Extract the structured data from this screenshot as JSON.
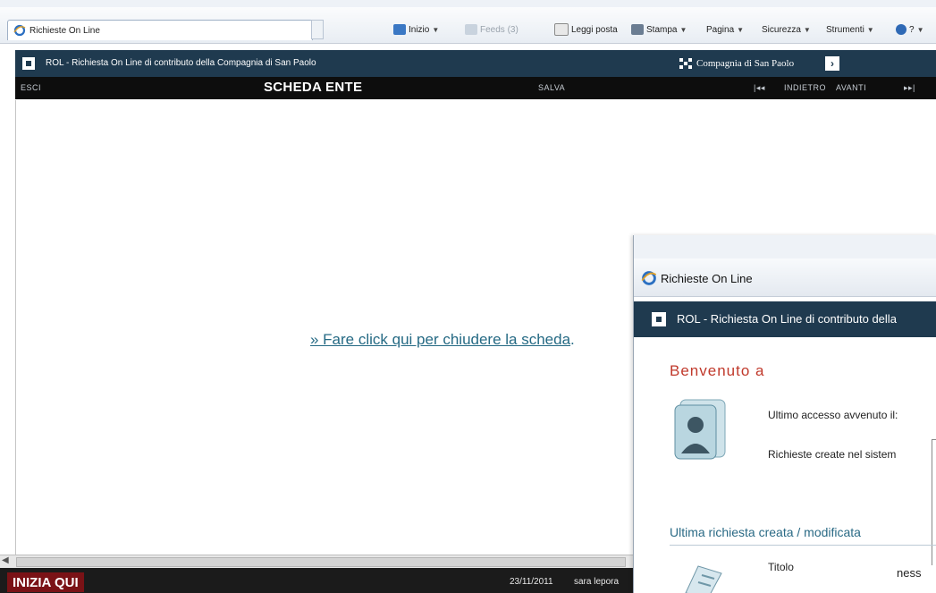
{
  "browser": {
    "tab_title": "Richieste On Line",
    "commands": {
      "home": "Inizio",
      "feeds": "Feeds (3)",
      "mail": "Leggi posta",
      "print": "Stampa",
      "page": "Pagina",
      "safety": "Sicurezza",
      "tools": "Strumenti",
      "help": "?"
    }
  },
  "header": {
    "title": "ROL - Richiesta On Line di contributo della Compagnia di San Paolo",
    "brand": "Compagnia di San Paolo"
  },
  "toolbar": {
    "exit": "ESCI",
    "section_title": "SCHEDA ENTE",
    "save": "SALVA",
    "first": "|◂◂",
    "back": "INDIETRO",
    "next": "AVANTI",
    "last": "▸▸|"
  },
  "content": {
    "close_link": "» Fare click qui per chiudere la scheda",
    "close_link_suffix": "."
  },
  "taskbar": {
    "start_label": "INIZIA QUI",
    "date": "23/11/2011",
    "user": "sara lepora"
  },
  "overlay": {
    "tab_title": "Richieste On Line",
    "header_title": "ROL - Richiesta On Line di contributo della",
    "welcome": "Benvenuto a",
    "last_access": "Ultimo accesso avvenuto il:",
    "requests_created": "Richieste create nel sistem",
    "last_request_heading": "Ultima richiesta creata / modificata",
    "title_label": "Titolo",
    "title_value": "ness"
  },
  "colors": {
    "header_bg": "#1f3a4f",
    "toolbar_bg": "#0d0d0d",
    "link": "#256a84",
    "welcome": "#c0392b",
    "start_bg": "#7a1216"
  }
}
